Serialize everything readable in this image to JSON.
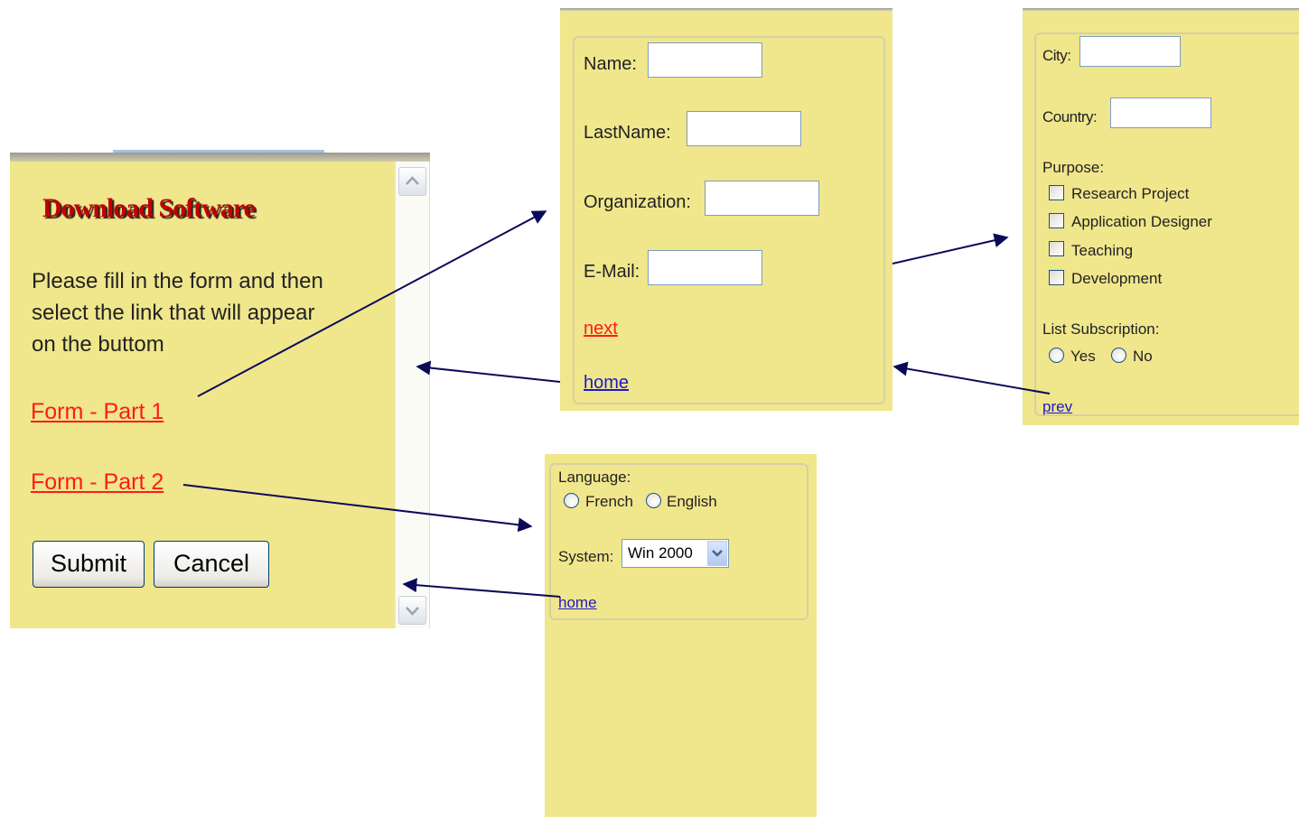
{
  "main": {
    "title": "Download Software",
    "instructions": [
      "Please fill in the form and then",
      "select the link that will appear",
      "on the buttom"
    ],
    "link_part1": "Form - Part 1",
    "link_part2": "Form - Part 2",
    "submit_label": "Submit",
    "cancel_label": "Cancel",
    "scroll_up_icon": "chevron-up-icon",
    "scroll_down_icon": "chevron-down-icon"
  },
  "part1": {
    "name_label": "Name:",
    "name_value": "",
    "lastname_label": "LastName:",
    "lastname_value": "",
    "organization_label": "Organization:",
    "organization_value": "",
    "email_label": "E-Mail:",
    "email_value": "",
    "next_link": "next",
    "home_link": "home"
  },
  "part1b": {
    "city_label": "City:",
    "city_value": "",
    "country_label": "Country:",
    "country_value": "",
    "purpose_label": "Purpose:",
    "purpose_options": [
      "Research Project",
      "Application Designer",
      "Teaching",
      "Development"
    ],
    "subscription_label": "List Subscription:",
    "subscription_options": [
      "Yes",
      "No"
    ],
    "prev_link": "prev"
  },
  "part2": {
    "language_label": "Language:",
    "language_options": [
      "French",
      "English"
    ],
    "system_label": "System:",
    "system_value": "Win 2000",
    "home_link": "home"
  },
  "colors": {
    "panel_bg": "#f0e68c",
    "link_red": "#ff1a1a",
    "link_blue": "#1a1acc",
    "arrow": "#0a0a5a"
  }
}
